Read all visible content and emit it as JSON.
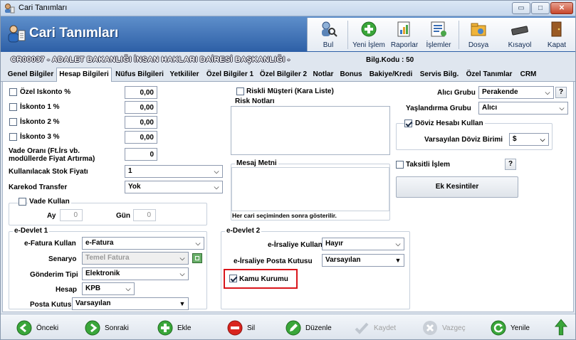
{
  "window": {
    "title": "Cari Tanımları",
    "minimize": "▭",
    "maximize": "□",
    "close": "✕"
  },
  "header": {
    "title": "Cari Tanımları"
  },
  "toolbar": [
    {
      "label": "Bul",
      "icon": "search-person-icon"
    },
    {
      "label": "Yeni İşlem",
      "icon": "add-green-icon"
    },
    {
      "label": "Raporlar",
      "icon": "report-icon"
    },
    {
      "label": "İşlemler",
      "icon": "operations-icon"
    },
    {
      "label": "Dosya",
      "icon": "folder-icon"
    },
    {
      "label": "Kısayol",
      "icon": "keyboard-icon"
    },
    {
      "label": "Kapat",
      "icon": "exit-door-icon"
    }
  ],
  "record": {
    "code": "CR00037 - ADALET BAKANLIĞI İNSAN HAKLARI DAİRESİ BAŞKANLIĞI -",
    "bilg": "Bilg.Kodu : 50"
  },
  "tabs": [
    "Genel Bilgiler",
    "Hesap Bilgileri",
    "Nüfus Bilgileri",
    "Yetkililer",
    "Özel Bilgiler 1",
    "Özel Bilgiler 2",
    "Notlar",
    "Bonus",
    "Bakiye/Kredi",
    "Servis Bilg.",
    "Özel Tanımlar",
    "CRM"
  ],
  "active_tab": "Hesap Bilgileri",
  "left": {
    "iskonto": [
      {
        "label": "Özel Iskonto %",
        "value": "0,00"
      },
      {
        "label": "İskonto 1 %",
        "value": "0,00"
      },
      {
        "label": "İskonto 2 %",
        "value": "0,00"
      },
      {
        "label": "İskonto 3 %",
        "value": "0,00"
      }
    ],
    "vade_orani_label": "Vade Oranı (Ft.İrs vb. modüllerde Fiyat Artırma)",
    "vade_orani_value": "0",
    "stok_fiyati_label": "Kullanılacak Stok Fiyatı",
    "stok_fiyati_value": "1",
    "karekod_label": "Karekod Transfer",
    "karekod_value": "Yok",
    "vade_kullan_label": "Vade Kullan",
    "ay_label": "Ay",
    "ay_value": "0",
    "gun_label": "Gün",
    "gun_value": "0"
  },
  "middle": {
    "riskli_label": "Riskli Müşteri (Kara Liste)",
    "risk_notlari_label": "Risk Notları",
    "mesaj_label": "Mesaj Metni",
    "mesaj_note": "Her cari seçiminden sonra gösterilir."
  },
  "right": {
    "alici_grubu_label": "Alıcı Grubu",
    "alici_grubu_value": "Perakende",
    "yaslandirma_label": "Yaşlandırma Grubu",
    "yaslandirma_value": "Alıcı",
    "doviz_label": "Döviz Hesabı Kullan",
    "doviz_birimi_label": "Varsayılan Döviz Birimi",
    "doviz_birimi_value": "$",
    "taksitli_label": "Taksitli İşlem",
    "ek_kesintiler": "Ek Kesintiler",
    "help": "?"
  },
  "edevlet1": {
    "title": "e-Devlet 1",
    "efatura_label": "e-Fatura Kullan",
    "efatura_value": "e-Fatura",
    "senaryo_label": "Senaryo",
    "senaryo_value": "Temel Fatura",
    "gonderim_label": "Gönderim Tipi",
    "gonderim_value": "Elektronik",
    "hesap_label": "Hesap",
    "hesap_value": "KPB",
    "posta_label": "Posta Kutusu",
    "posta_value": "Varsayılan"
  },
  "edevlet2": {
    "title": "e-Devlet 2",
    "eirsaliye_label": "e-İrsaliye Kullan",
    "eirsaliye_value": "Hayır",
    "eirs_posta_label": "e-İrsaliye Posta Kutusu",
    "eirs_posta_value": "Varsayılan",
    "kamu_label": "Kamu Kurumu"
  },
  "footer": [
    {
      "label": "Önceki",
      "icon": "arrow-left-icon",
      "enabled": true
    },
    {
      "label": "Sonraki",
      "icon": "arrow-right-icon",
      "enabled": true
    },
    {
      "label": "Ekle",
      "icon": "plus-icon",
      "enabled": true
    },
    {
      "label": "Sil",
      "icon": "minus-icon",
      "enabled": true
    },
    {
      "label": "Düzenle",
      "icon": "edit-icon",
      "enabled": true
    },
    {
      "label": "Kaydet",
      "icon": "check-icon",
      "enabled": false
    },
    {
      "label": "Vazgeç",
      "icon": "cancel-icon",
      "enabled": false
    },
    {
      "label": "Yenile",
      "icon": "refresh-icon",
      "enabled": true
    }
  ],
  "colors": {
    "header": "#3a6db3",
    "highlight": "#d9151b",
    "green": "#3aa63a"
  }
}
